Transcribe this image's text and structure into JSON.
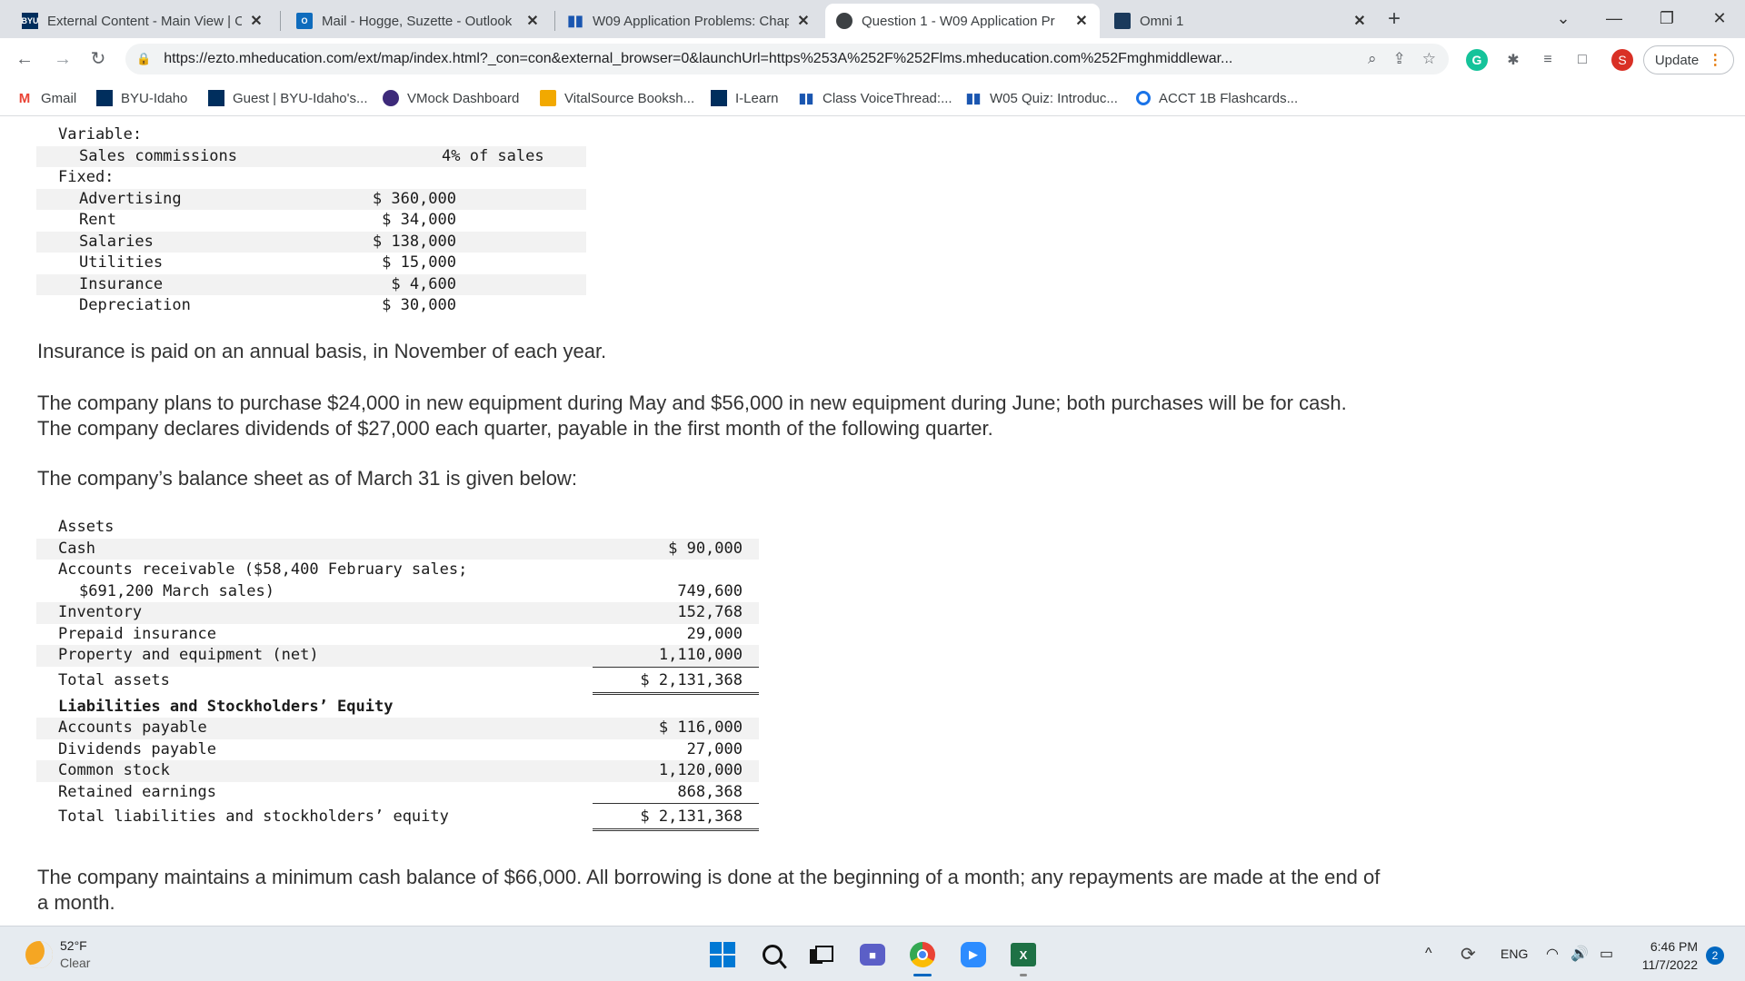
{
  "browser": {
    "tabs": [
      {
        "title": "External Content - Main View | O",
        "active": false
      },
      {
        "title": "Mail - Hogge, Suzette - Outlook",
        "active": false
      },
      {
        "title": "W09 Application Problems: Chap",
        "active": false
      },
      {
        "title": "Question 1 - W09 Application Pr",
        "active": true
      },
      {
        "title": "Omni 1",
        "active": false
      }
    ],
    "favicon_labels": {
      "byu": "BYU",
      "mail": "O"
    },
    "close_glyph": "✕",
    "new_tab_glyph": "+",
    "window_controls": {
      "tab_search": "⌄",
      "minimize": "—",
      "restore": "❐",
      "close": "✕"
    },
    "url": "https://ezto.mheducation.com/ext/map/index.html?_con=con&external_browser=0&launchUrl=https%253A%252F%252Flms.mheducation.com%252Fmghmiddlewar...",
    "profile_initial": "S",
    "extension_initial": "G",
    "update_label": "Update",
    "update_dots": "⋮",
    "bookmarks": [
      {
        "label": "Gmail",
        "icon": "gmail-icon"
      },
      {
        "label": "BYU-Idaho",
        "icon": "byu-idaho-icon"
      },
      {
        "label": "Guest | BYU-Idaho's...",
        "icon": "byu-icon"
      },
      {
        "label": "VMock Dashboard",
        "icon": "vmock-icon"
      },
      {
        "label": "VitalSource Booksh...",
        "icon": "vitalsource-icon"
      },
      {
        "label": "I-Learn",
        "icon": "byu-icon"
      },
      {
        "label": "Class VoiceThread:...",
        "icon": "bars-icon"
      },
      {
        "label": "W05 Quiz: Introduc...",
        "icon": "bars-icon"
      },
      {
        "label": "ACCT 1B Flashcards...",
        "icon": "quizlet-icon"
      }
    ]
  },
  "budget": {
    "variable_heading": "Variable:",
    "sales_commissions_label": "Sales commissions",
    "sales_commissions_value": "4% of sales",
    "fixed_heading": "Fixed:",
    "fixed_items": [
      {
        "label": "Advertising",
        "amount": "$ 360,000"
      },
      {
        "label": "Rent",
        "amount": "$ 34,000"
      },
      {
        "label": "Salaries",
        "amount": "$ 138,000"
      },
      {
        "label": "Utilities",
        "amount": "$ 15,000"
      },
      {
        "label": "Insurance",
        "amount": "$ 4,600"
      },
      {
        "label": "Depreciation",
        "amount": "$ 30,000"
      }
    ]
  },
  "text": {
    "insurance_note": "Insurance is paid on an annual basis, in November of each year.",
    "equipment_note": "The company plans to purchase $24,000 in new equipment during May and $56,000 in new equipment during June; both purchases will be for cash. The company declares dividends of $27,000 each quarter, payable in the first month of the following quarter.",
    "balance_intro": "The company’s balance sheet as of March 31 is given below:",
    "cash_policy": "The company maintains a minimum cash balance of $66,000. All borrowing is done at the beginning of a month; any repayments are made at the end of a month."
  },
  "balance_sheet": {
    "assets_heading": "Assets",
    "cash_label": "Cash",
    "cash_value": "$ 90,000",
    "ar_label_1": "Accounts receivable ($58,400 February sales;",
    "ar_label_2": "$691,200 March sales)",
    "ar_value": "749,600",
    "inventory_label": "Inventory",
    "inventory_value": "152,768",
    "prepaid_label": "Prepaid insurance",
    "prepaid_value": "29,000",
    "ppe_label": "Property and equipment (net)",
    "ppe_value": "1,110,000",
    "total_assets_label": "Total assets",
    "total_assets_value": "$ 2,131,368",
    "liab_heading": "Liabilities and Stockholders’ Equity",
    "ap_label": "Accounts payable",
    "ap_value": "$ 116,000",
    "div_label": "Dividends payable",
    "div_value": "27,000",
    "cs_label": "Common stock",
    "cs_value": "1,120,000",
    "re_label": "Retained earnings",
    "re_value": "868,368",
    "total_le_label": "Total liabilities and stockholders’ equity",
    "total_le_value": "$ 2,131,368"
  },
  "taskbar": {
    "temperature": "52°F",
    "condition": "Clear",
    "language": "ENG",
    "time": "6:46 PM",
    "date": "11/7/2022",
    "notification_count": "2",
    "excel_letter": "X",
    "teams_glyph": "■",
    "zoom_glyph": "▶"
  },
  "colors": {
    "accent": "#0067c0",
    "tab_strip": "#dee1e6",
    "taskbar": "#e6ebf0"
  }
}
